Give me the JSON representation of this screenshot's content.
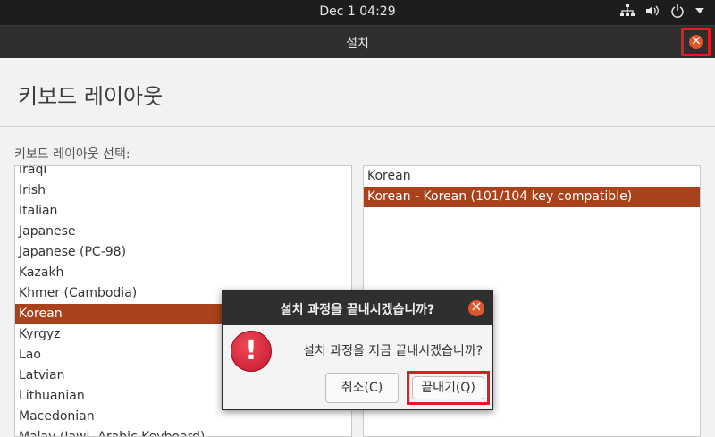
{
  "topbar": {
    "clock": "Dec 1  04:29",
    "tray_icons": [
      "network-icon",
      "volume-icon",
      "power-icon",
      "chevron-down-icon"
    ]
  },
  "window": {
    "title": "설치"
  },
  "page": {
    "heading": "키보드 레이아웃",
    "select_label": "키보드 레이아웃 선택:",
    "layouts": [
      "Iraqi",
      "Irish",
      "Italian",
      "Japanese",
      "Japanese (PC-98)",
      "Kazakh",
      "Khmer (Cambodia)",
      "Korean",
      "Kyrgyz",
      "Lao",
      "Latvian",
      "Lithuanian",
      "Macedonian",
      "Malay (Jawi, Arabic Keyboard)"
    ],
    "selected_layout": "Korean",
    "variants": [
      "Korean",
      "Korean - Korean (101/104 key compatible)"
    ],
    "selected_variant": "Korean - Korean (101/104 key compatible)"
  },
  "dialog": {
    "title": "설치 과정을 끝내시겠습니까?",
    "message": "설치 과정을 지금 끝내시겠습니까?",
    "cancel_label": "취소(C)",
    "quit_label": "끝내기(Q)"
  },
  "colors": {
    "accent": "#a9411a",
    "highlight": "#e41b23",
    "close": "#e0562a"
  }
}
